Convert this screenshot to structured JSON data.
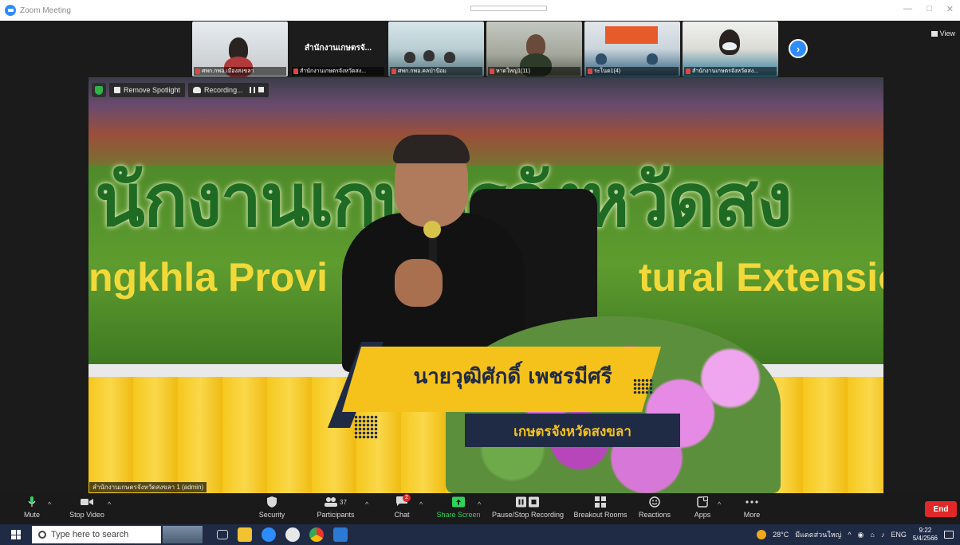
{
  "window": {
    "title": "Zoom Meeting"
  },
  "thumbnails": [
    {
      "label": "ศพก.กพอ.เมืองสงขลา",
      "big_name": ""
    },
    {
      "label": "สำนักงานเกษตรจังหวัดสง...",
      "big_name": "สำนักงานเกษตรจั..."
    },
    {
      "label": "ศพก.กพอ.คลป่าป้อม",
      "big_name": ""
    },
    {
      "label": "หาดใหญ่1(11)",
      "big_name": ""
    },
    {
      "label": "ระโนด1(4)",
      "big_name": ""
    },
    {
      "label": "สำนักงานเกษตรจังหวัดสง...",
      "big_name": ""
    }
  ],
  "view_label": "View",
  "video_controls": {
    "spotlight": "Remove Spotlight",
    "recording": "Recording..."
  },
  "stage": {
    "backdrop_thai": "นักงานเกษตรจังหวัดสง",
    "backdrop_eng_left": "ngkhla Provi",
    "backdrop_eng_right": "tural Extensio",
    "speaker_name": "นายวุฒิศักดิ์ เพชรมีศรี",
    "speaker_title": "เกษตรจังหวัดสงขลา"
  },
  "video_label": "สำนักงานเกษตรจังหวัดสงขลา 1 (admin)",
  "toolbar": {
    "mute": "Mute",
    "stop_video": "Stop Video",
    "security": "Security",
    "participants": "Participants",
    "participants_count": "37",
    "chat": "Chat",
    "chat_badge": "2",
    "share_screen": "Share Screen",
    "pause_recording": "Pause/Stop Recording",
    "breakout": "Breakout Rooms",
    "reactions": "Reactions",
    "apps": "Apps",
    "more": "More",
    "end": "End"
  },
  "taskbar": {
    "search_placeholder": "Type here to search",
    "weather": "28°C",
    "weather_text": "มีแดดส่วนใหญ่",
    "lang": "ENG",
    "time": "9:22",
    "date": "5/4/2566"
  },
  "colors": {
    "zoom_blue": "#2d8cff",
    "end_red": "#e02828",
    "share_green": "#2fd25a",
    "banner_yellow": "#f5c21c",
    "banner_navy": "#1f2a45"
  }
}
